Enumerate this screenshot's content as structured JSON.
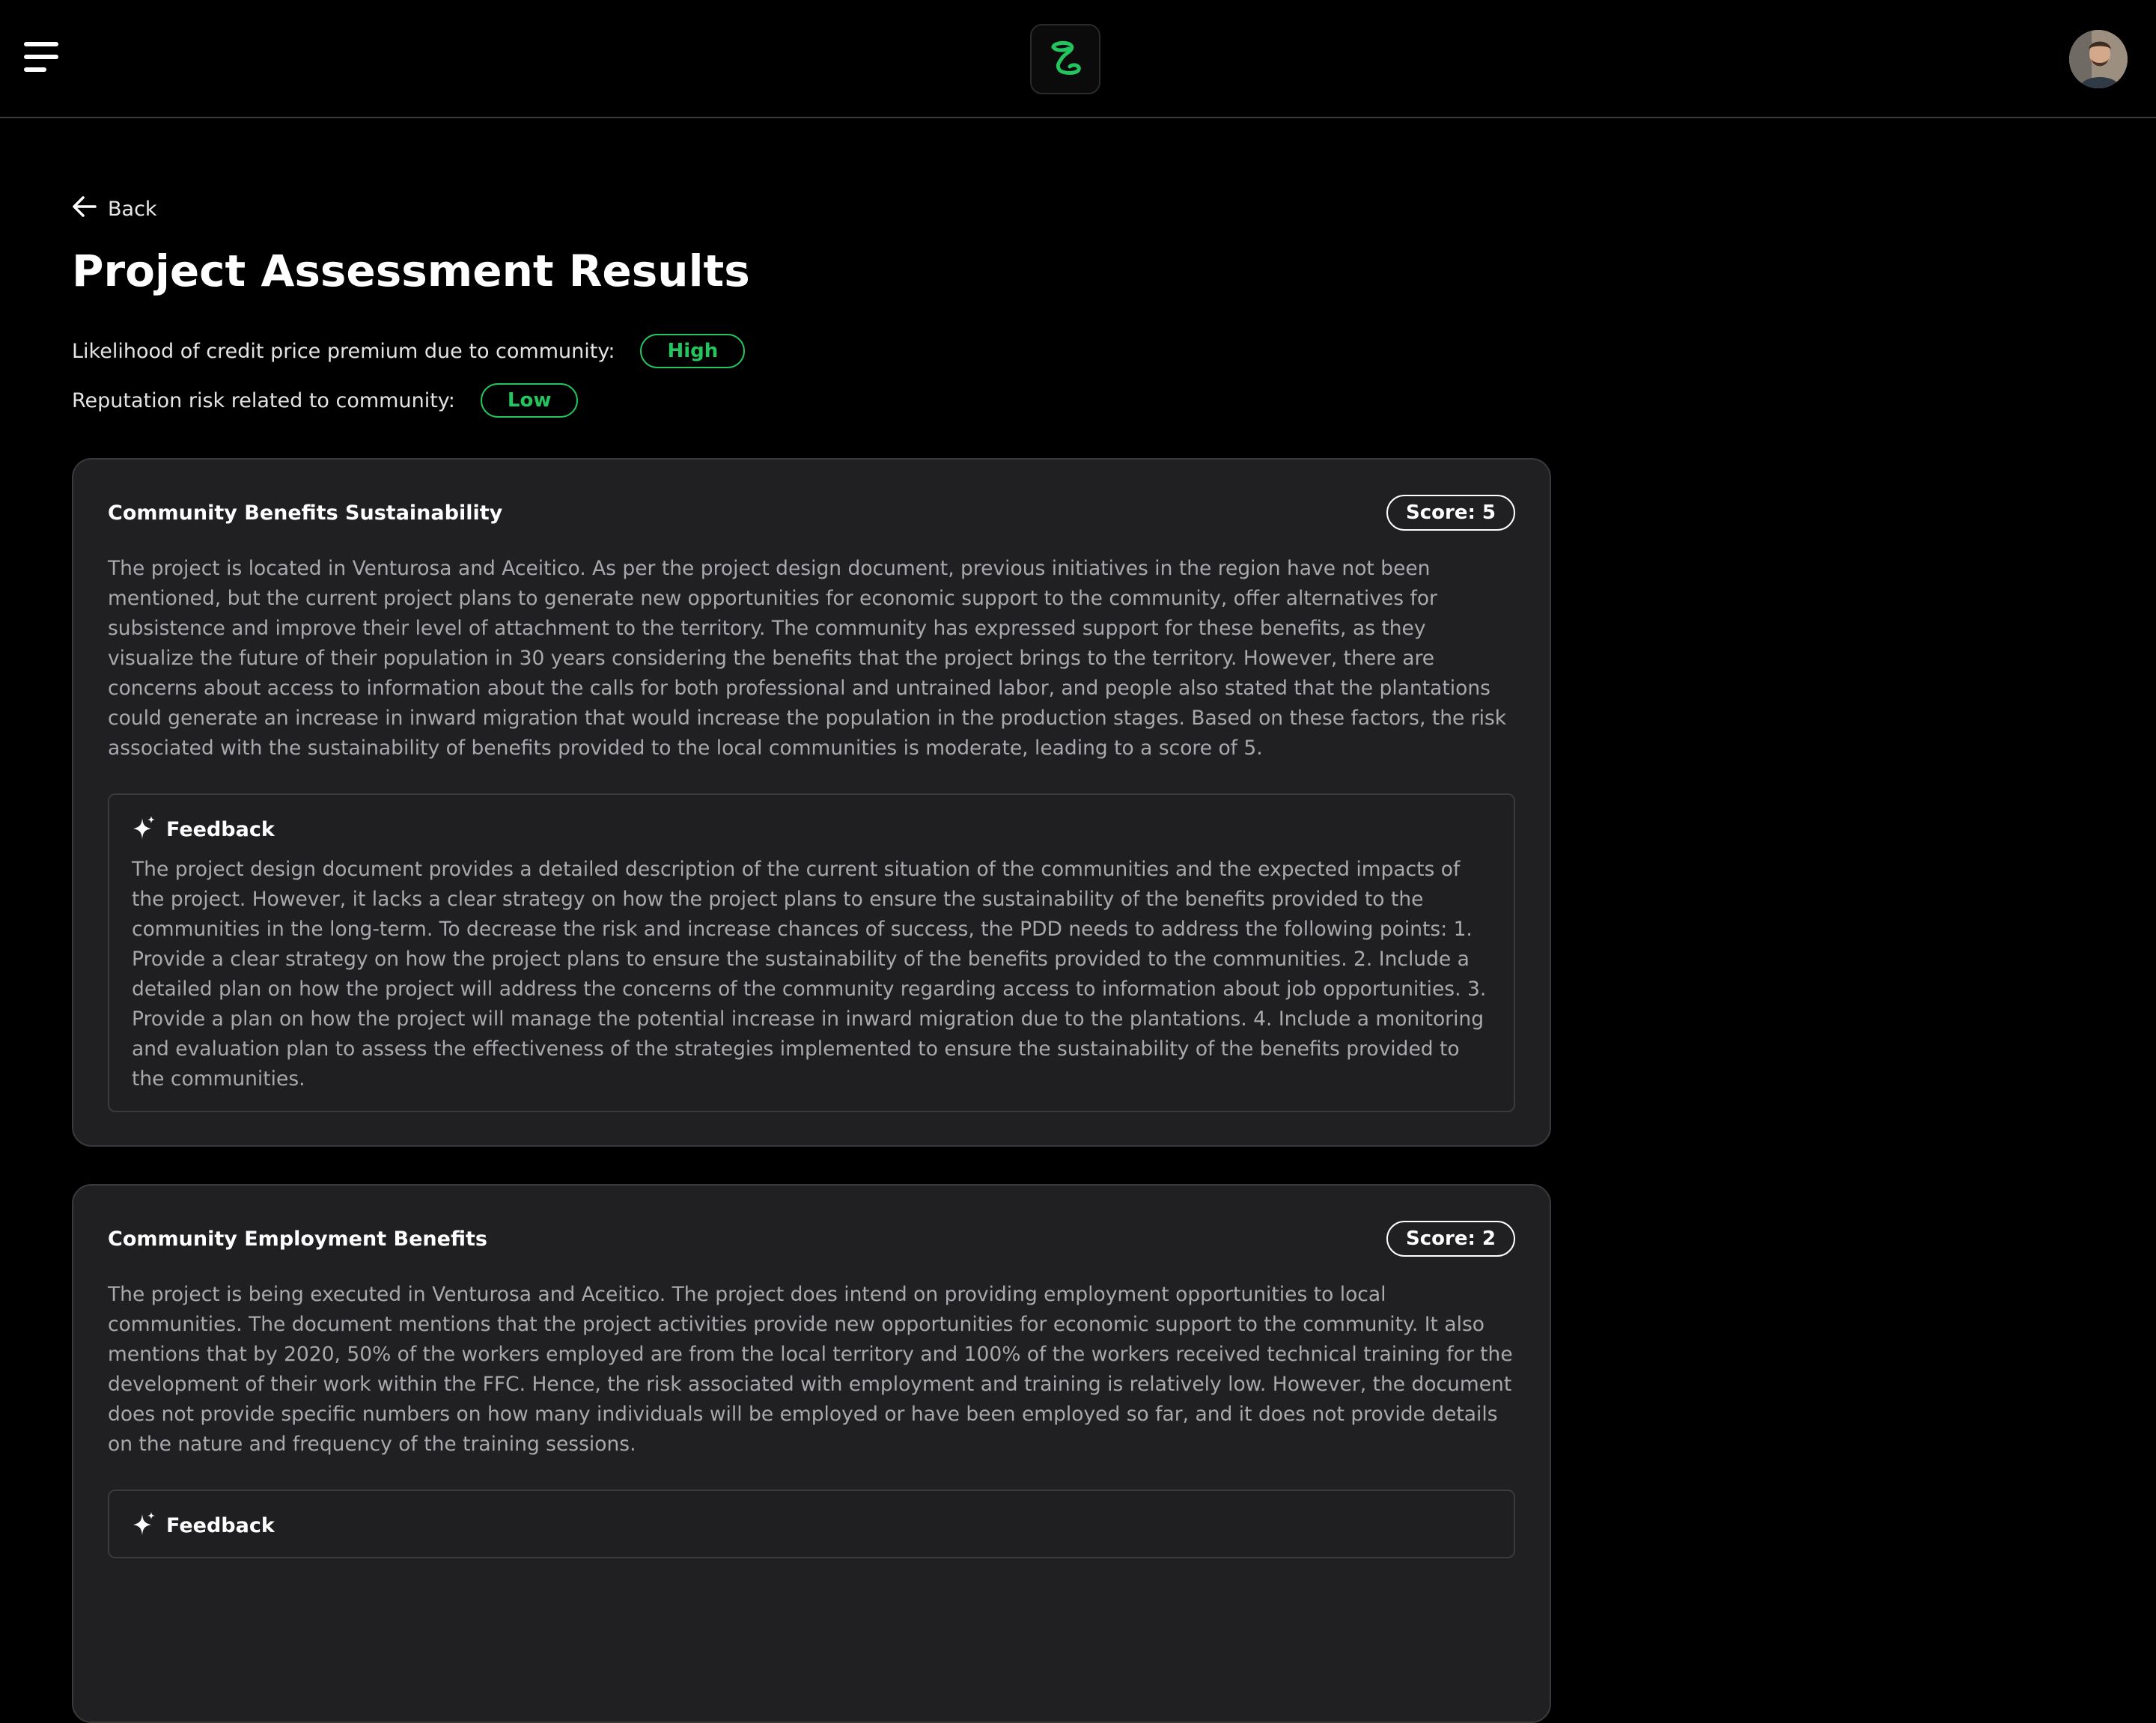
{
  "nav": {
    "menu_icon": "hamburger-menu-icon",
    "logo_icon": "app-logo-icon",
    "accent_color": "#22c55e"
  },
  "back": {
    "label": "Back",
    "icon": "arrow-left-icon"
  },
  "page": {
    "title": "Project Assessment Results"
  },
  "metrics": [
    {
      "label": "Likelihood of credit price premium due to community:",
      "value": "High"
    },
    {
      "label": "Reputation risk related to community:",
      "value": "Low"
    }
  ],
  "cards": [
    {
      "title": "Community Benefits Sustainability",
      "score": "Score: 5",
      "body": "The project is located in Venturosa and Aceitico. As per the project design document, previous initiatives in the region have not been mentioned, but the current project plans to generate new opportunities for economic support to the community, offer alternatives for subsistence and improve their level of attachment to the territory. The community has expressed support for these benefits, as they visualize the future of their population in 30 years considering the benefits that the project brings to the territory. However, there are concerns about access to information about the calls for both professional and untrained labor, and people also stated that the plantations could generate an increase in inward migration that would increase the population in the production stages. Based on these factors, the risk associated with the sustainability of benefits provided to the local communities is moderate, leading to a score of 5.",
      "feedback_title": "Feedback",
      "feedback_icon": "sparkles-icon",
      "feedback": "The project design document provides a detailed description of the current situation of the communities and the expected impacts of the project. However, it lacks a clear strategy on how the project plans to ensure the sustainability of the benefits provided to the communities in the long-term. To decrease the risk and increase chances of success, the PDD needs to address the following points: 1. Provide a clear strategy on how the project plans to ensure the sustainability of the benefits provided to the communities. 2. Include a detailed plan on how the project will address the concerns of the community regarding access to information about job opportunities. 3. Provide a plan on how the project will manage the potential increase in inward migration due to the plantations. 4. Include a monitoring and evaluation plan to assess the effectiveness of the strategies implemented to ensure the sustainability of the benefits provided to the communities."
    },
    {
      "title": "Community Employment Benefits",
      "score": "Score: 2",
      "body": "The project is being executed in Venturosa and Aceitico. The project does intend on providing employment opportunities to local communities. The document mentions that the project activities provide new opportunities for economic support to the community. It also mentions that by 2020, 50% of the workers employed are from the local territory and 100% of the workers received technical training for the development of their work within the FFC. Hence, the risk associated with employment and training is relatively low. However, the document does not provide specific numbers on how many individuals will be employed or have been employed so far, and it does not provide details on the nature and frequency of the training sessions.",
      "feedback_title": "Feedback",
      "feedback_icon": "sparkles-icon"
    }
  ]
}
